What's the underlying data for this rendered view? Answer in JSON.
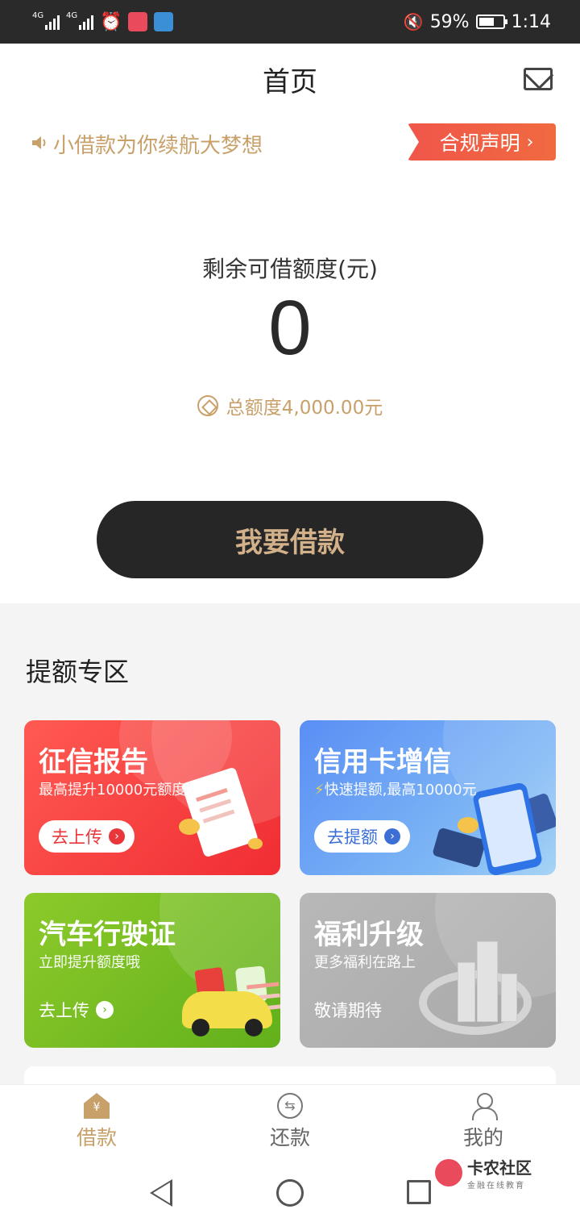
{
  "status_bar": {
    "network_1": "4G",
    "network_2": "4G",
    "battery_percent": "59%",
    "time": "1:14"
  },
  "header": {
    "title": "首页"
  },
  "notice": {
    "text": "小借款为你续航大梦想",
    "compliance_label": "合规声明"
  },
  "credit": {
    "label": "剩余可借额度(元)",
    "amount": "0",
    "total": "总额度4,000.00元"
  },
  "borrow_button": "我要借款",
  "boost": {
    "section_title": "提额专区",
    "cards": [
      {
        "title": "征信报告",
        "subtitle": "最高提升10000元额度",
        "action": "去上传"
      },
      {
        "title": "信用卡增信",
        "subtitle": "快速提额,最高10000元",
        "action": "去提额"
      },
      {
        "title": "汽车行驶证",
        "subtitle": "立即提升额度哦",
        "action": "去上传"
      },
      {
        "title": "福利升级",
        "subtitle": "更多福利在路上",
        "action": "敬请期待"
      }
    ]
  },
  "tabs": [
    {
      "label": "借款",
      "active": true
    },
    {
      "label": "还款",
      "active": false
    },
    {
      "label": "我的",
      "active": false
    }
  ],
  "watermark": {
    "main": "卡农社区",
    "sub": "金融在线教育"
  },
  "colors": {
    "gold": "#c8a06a",
    "dark": "#262626",
    "red": "#f02d33",
    "blue": "#5a8ef5",
    "green": "#62b01c",
    "gray": "#a8a8a8"
  }
}
